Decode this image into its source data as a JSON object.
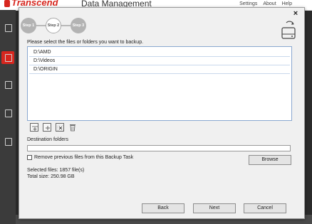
{
  "app": {
    "brand": "Transcend",
    "title": "Data Management",
    "links": [
      "Settings",
      "About",
      "Help"
    ]
  },
  "dialog": {
    "close_glyph": "×",
    "steps": [
      {
        "label": "Step 1",
        "state": "done"
      },
      {
        "label": "Step 2",
        "state": "current"
      },
      {
        "label": "Step 3",
        "state": "pending"
      }
    ],
    "instruction": "Please select the files or folders you want to backup.",
    "files": [
      "D:\\AMD",
      "D:\\Videos",
      "D:\\ORIGIN"
    ],
    "toolbar_icons": [
      "add-folder-icon",
      "add-file-icon",
      "remove-selected-icon",
      "delete-icon"
    ],
    "destination_label": "Destination folders",
    "destination_value": "",
    "remove_previous_label": "Remove previous files from this Backup Task",
    "remove_previous_checked": false,
    "browse_label": "Browse",
    "selected_files": "Selected files:  1857 file(s)",
    "total_size": "Total size:  250.98 GB",
    "buttons": {
      "back": "Back",
      "next": "Next",
      "cancel": "Cancel"
    }
  },
  "colors": {
    "brand": "#d7261e",
    "step_gray": "#b3b3b3",
    "list_border": "#8aa8d0"
  }
}
